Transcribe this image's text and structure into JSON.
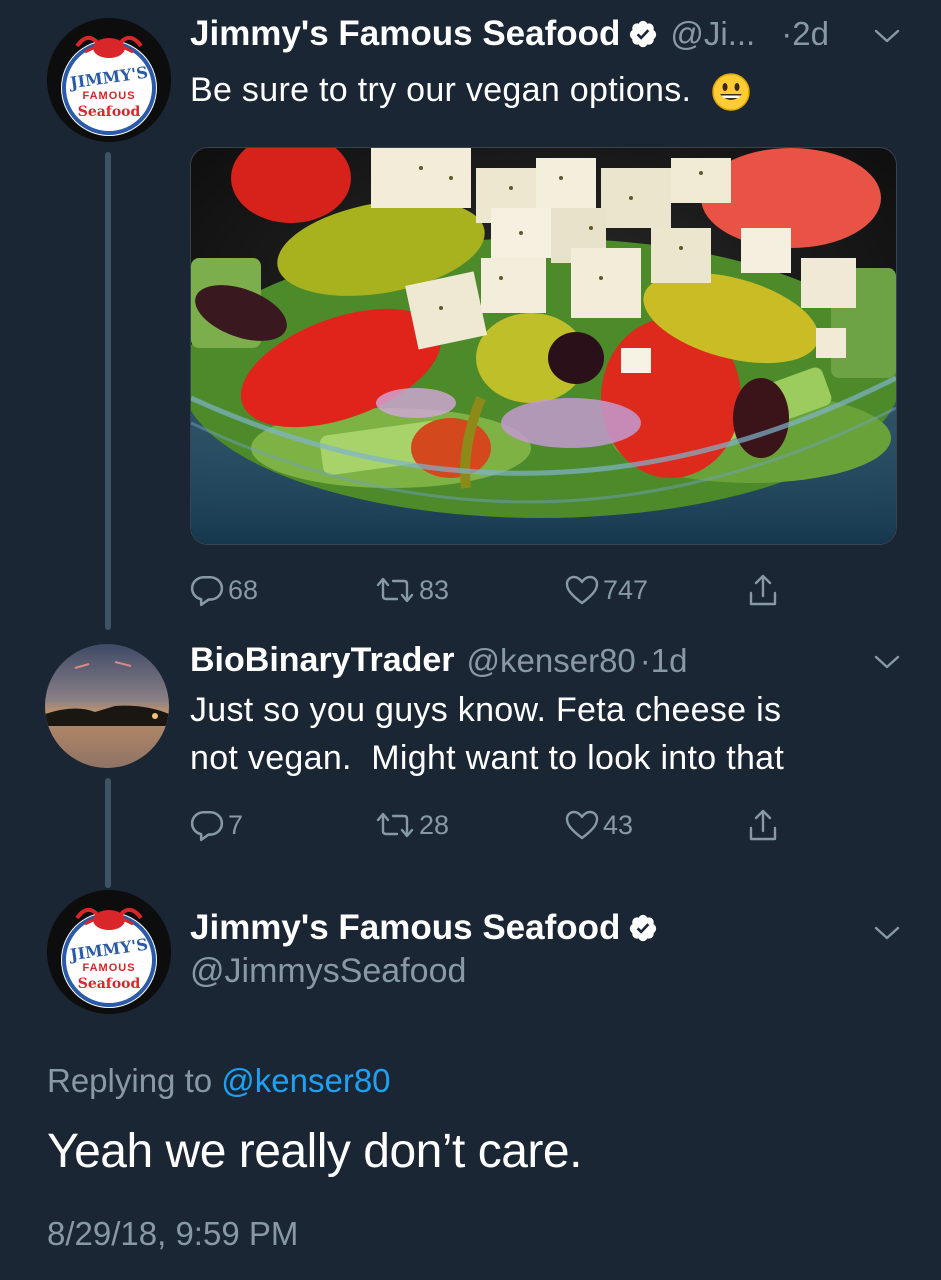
{
  "tweet1": {
    "author_name": "Jimmy's Famous Seafood",
    "handle": "@Ji...",
    "time": "·2d",
    "text": "Be sure to try our vegan options.",
    "emoji": "😃",
    "avatar": {
      "line1": "JIMMY'S",
      "line2": "FAMOUS",
      "line3": "Seafood"
    },
    "reply_count": "68",
    "retweet_count": "83",
    "like_count": "747"
  },
  "tweet2": {
    "author_name": "BioBinaryTrader",
    "handle": "@kenser80",
    "time": "·1d",
    "text_line1": "Just so you guys know. Feta cheese is",
    "text_line2": "not vegan.  Might want to look into that",
    "reply_count": "7",
    "retweet_count": "28",
    "like_count": "43"
  },
  "tweet3": {
    "author_name": "Jimmy's Famous Seafood",
    "handle": "@JimmysSeafood",
    "avatar": {
      "line1": "JIMMY'S",
      "line2": "FAMOUS",
      "line3": "Seafood"
    },
    "replying_prefix": "Replying to",
    "replying_mention": "@kenser80",
    "text": "Yeah we really don’t care.",
    "timestamp": "8/29/18, 9:59 PM"
  },
  "colors": {
    "background": "#1b2634",
    "muted": "#8899a6",
    "link": "#1da1f2",
    "thread_line": "#3d5466"
  },
  "icons": [
    "verified-badge-icon",
    "chevron-down-icon",
    "reply-icon",
    "retweet-icon",
    "like-icon",
    "share-icon"
  ]
}
